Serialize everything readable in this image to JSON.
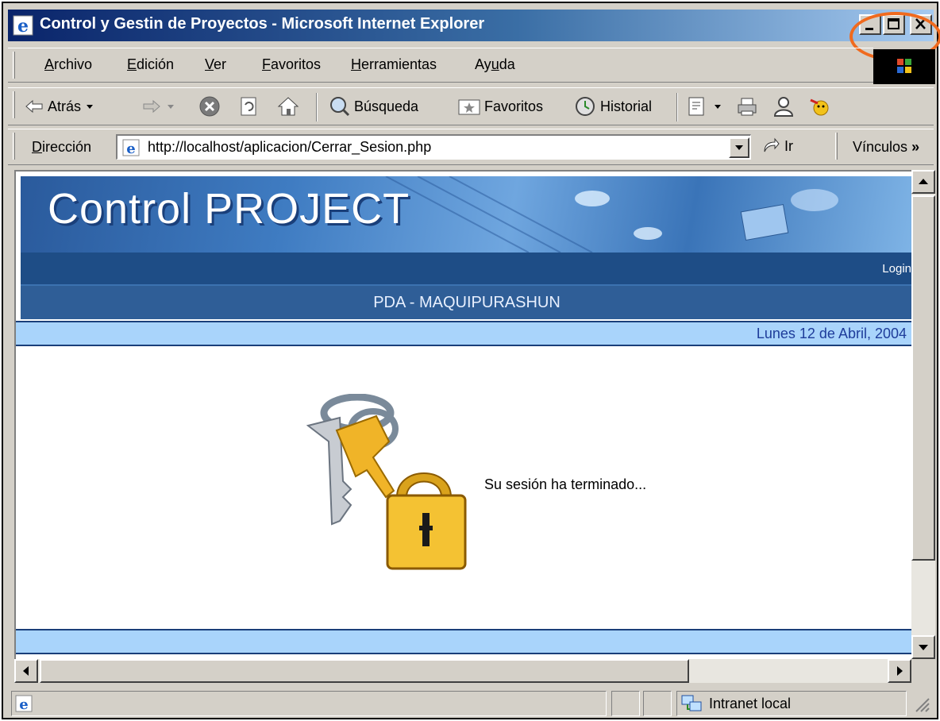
{
  "window": {
    "title": "Control y Gestin de Proyectos - Microsoft Internet Explorer"
  },
  "menu": {
    "items": [
      {
        "label": "Archivo",
        "access": "A",
        "rest": "rchivo"
      },
      {
        "label": "Edición",
        "access": "E",
        "rest": "dición"
      },
      {
        "label": "Ver",
        "access": "V",
        "rest": "er"
      },
      {
        "label": "Favoritos",
        "access": "F",
        "rest": "avoritos"
      },
      {
        "label": "Herramientas",
        "access": "H",
        "rest": "erramientas"
      },
      {
        "label": "Ayuda",
        "access_pre": "Ay",
        "access": "u",
        "rest": "da"
      }
    ]
  },
  "toolbar": {
    "back_label": "Atrás",
    "search_label": "Búsqueda",
    "favorites_label": "Favoritos",
    "history_label": "Historial"
  },
  "address": {
    "label_access": "D",
    "label_rest": "irección",
    "url": "http://localhost/aplicacion/Cerrar_Sesion.php",
    "go_label": "Ir",
    "links_label": "Vínculos",
    "links_chevron": "»"
  },
  "page": {
    "banner_title": "Control PROJECT",
    "login_link": "Login",
    "subtitle": "PDA - MAQUIPURASHUN",
    "date": "Lunes 12 de Abril, 2004",
    "session_message": "Su sesión ha terminado..."
  },
  "status": {
    "zone": "Intranet local"
  },
  "colors": {
    "annotation_circle": "#f06a1e",
    "title_bar": "#0a246a",
    "date_bar": "#a9d4fb",
    "date_text": "#1e3c9a",
    "nav_dark": "#1e4d86"
  },
  "icons": [
    "ie-logo-icon",
    "back-arrow-icon",
    "forward-arrow-icon",
    "stop-icon",
    "refresh-icon",
    "home-icon",
    "search-icon",
    "favorites-icon",
    "history-icon",
    "edit-icon",
    "print-icon",
    "messenger-icon",
    "keys-lock-icon",
    "go-arrow-icon",
    "intranet-zone-icon"
  ]
}
